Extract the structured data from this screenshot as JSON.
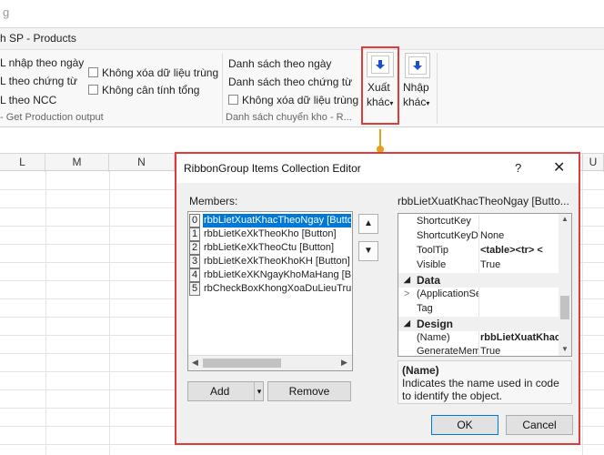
{
  "ribbon": {
    "top_faded_text": "g",
    "tab_text": "h SP - Products",
    "group1": {
      "items": [
        "L nhập theo ngày",
        "L theo chứng từ",
        "L theo NCC"
      ],
      "label": "- Get Production output"
    },
    "group2": {
      "checkboxes": [
        "Không xóa dữ liệu trùng",
        "Không cân tính tổng"
      ]
    },
    "group3": {
      "items": [
        "Danh sách theo ngày",
        "Danh sách theo chứng từ"
      ],
      "checkbox": "Không xóa dữ liệu trùng",
      "label": "Danh sách chuyển kho - R..."
    },
    "xuat_button": {
      "line1": "Xuất",
      "line2": "khác"
    },
    "nhap_button": {
      "line1": "Nhập",
      "line2": "khác"
    }
  },
  "grid": {
    "columns": [
      "L",
      "M",
      "N",
      "U"
    ]
  },
  "dialog": {
    "title": "RibbonGroup Items Collection Editor",
    "help_glyph": "?",
    "close_glyph": "✕",
    "members_label": "Members:",
    "members": [
      {
        "index": "0",
        "name": "rbbLietXuatKhacTheoNgay [Button]"
      },
      {
        "index": "1",
        "name": "rbbLietKeXkTheoKho [Button]"
      },
      {
        "index": "2",
        "name": "rbbLietKeXkTheoCtu [Button]"
      },
      {
        "index": "3",
        "name": "rbbLietKeXkTheoKhoKH [Button]"
      },
      {
        "index": "4",
        "name": "rbbLietKeXKNgayKhoMaHang [Button]"
      },
      {
        "index": "5",
        "name": "rbCheckBoxKhongXoaDuLieuTrung"
      }
    ],
    "selected_member": 0,
    "up_arrow": "▲",
    "down_arrow": "▼",
    "add_label": "Add",
    "add_dropdown": "▾",
    "remove_label": "Remove",
    "properties_title": "rbbLietXuatKhacTheoNgay [Butto...",
    "properties": [
      {
        "kind": "prop",
        "name": "ShortcutKey",
        "value": ""
      },
      {
        "kind": "prop",
        "name": "ShortcutKeyDisplayString",
        "value": "None"
      },
      {
        "kind": "prop",
        "name": "ToolTip",
        "value": "<table><tr> <"
      },
      {
        "kind": "prop",
        "name": "Visible",
        "value": "True"
      },
      {
        "kind": "cat",
        "name": "Data",
        "toggle": "◢"
      },
      {
        "kind": "prop",
        "name": "(ApplicationSettings)",
        "value": "",
        "expander": ">"
      },
      {
        "kind": "prop",
        "name": "Tag",
        "value": ""
      },
      {
        "kind": "cat",
        "name": "Design",
        "toggle": "◢"
      },
      {
        "kind": "prop",
        "name": "(Name)",
        "value": "rbbLietXuatKhacTheoNgay",
        "bold": true
      },
      {
        "kind": "prop",
        "name": "GenerateMember",
        "value": "True"
      }
    ],
    "description": {
      "title": "(Name)",
      "text": "Indicates the name used in code to identify the object."
    },
    "ok_label": "OK",
    "cancel_label": "Cancel"
  }
}
